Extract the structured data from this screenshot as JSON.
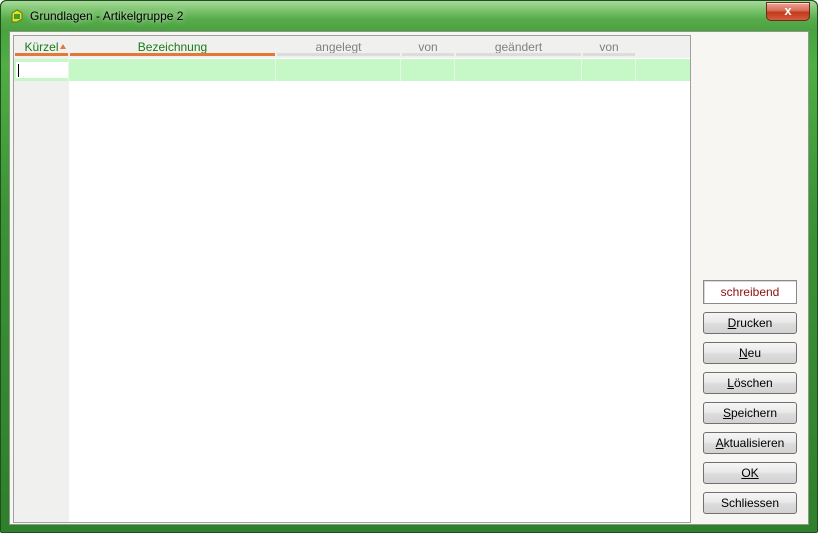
{
  "window": {
    "title": "Grundlagen - Artikelgruppe 2",
    "close_symbol": "x"
  },
  "grid": {
    "columns": [
      {
        "label": "Kürzel",
        "state": "active-sorted-asc"
      },
      {
        "label": "Bezeichnung",
        "state": "active"
      },
      {
        "label": "angelegt",
        "state": "normal"
      },
      {
        "label": "von",
        "state": "normal"
      },
      {
        "label": "geändert",
        "state": "normal"
      },
      {
        "label": "von",
        "state": "normal"
      }
    ],
    "rows": [
      {
        "cells": [
          "",
          "",
          "",
          "",
          "",
          ""
        ],
        "selected": true
      }
    ]
  },
  "side_panel": {
    "status_text": "schreibend",
    "buttons": [
      {
        "label_mnemonic": "D",
        "label_rest": "rucken"
      },
      {
        "label_mnemonic": "N",
        "label_rest": "eu"
      },
      {
        "label_mnemonic": "L",
        "label_rest": "öschen"
      },
      {
        "label_mnemonic": "S",
        "label_rest": "peichern"
      },
      {
        "label_mnemonic": "A",
        "label_rest": "ktualisieren"
      },
      {
        "label_mnemonic": "O",
        "label_rest": "K"
      },
      {
        "label_mnemonic": "",
        "label_rest": "Schliessen"
      }
    ]
  },
  "colors": {
    "header_active": "#1b7a1b",
    "header_inactive": "#808080",
    "sort_accent": "#e2793b",
    "selected_row": "#c6f7c6",
    "status_text": "#8b1010",
    "title_bar": "#58ac4c"
  },
  "icons": {
    "app": "green-leaf-icon",
    "sort": "sort-ascending-icon",
    "close": "close-icon"
  }
}
